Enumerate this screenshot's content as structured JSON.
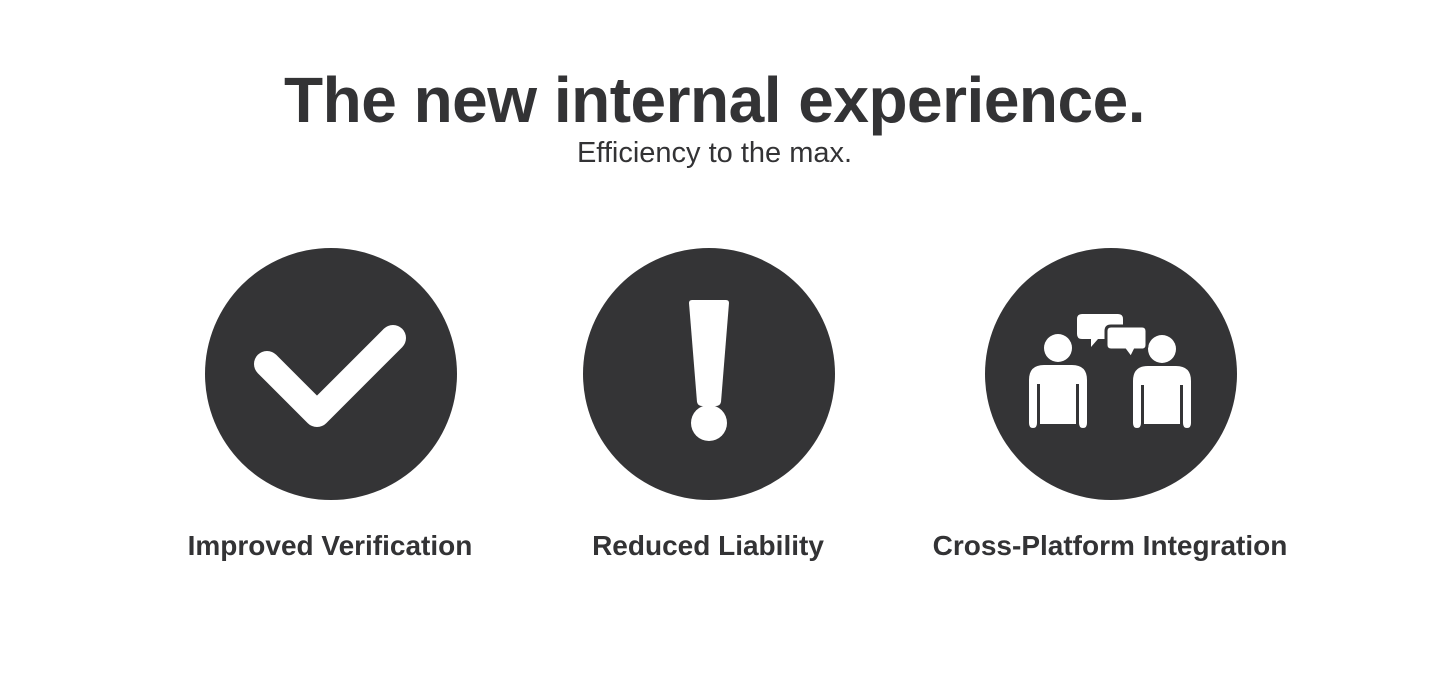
{
  "header": {
    "title": "The new internal experience.",
    "subtitle": "Efficiency to the max."
  },
  "colors": {
    "icon_background": "#343436",
    "icon_foreground": "#ffffff",
    "text": "#333335",
    "page_background": "#ffffff"
  },
  "features": [
    {
      "icon": "checkmark-icon",
      "label": "Improved Verification"
    },
    {
      "icon": "exclamation-icon",
      "label": "Reduced Liability"
    },
    {
      "icon": "people-chat-icon",
      "label": "Cross-Platform Integration"
    }
  ]
}
